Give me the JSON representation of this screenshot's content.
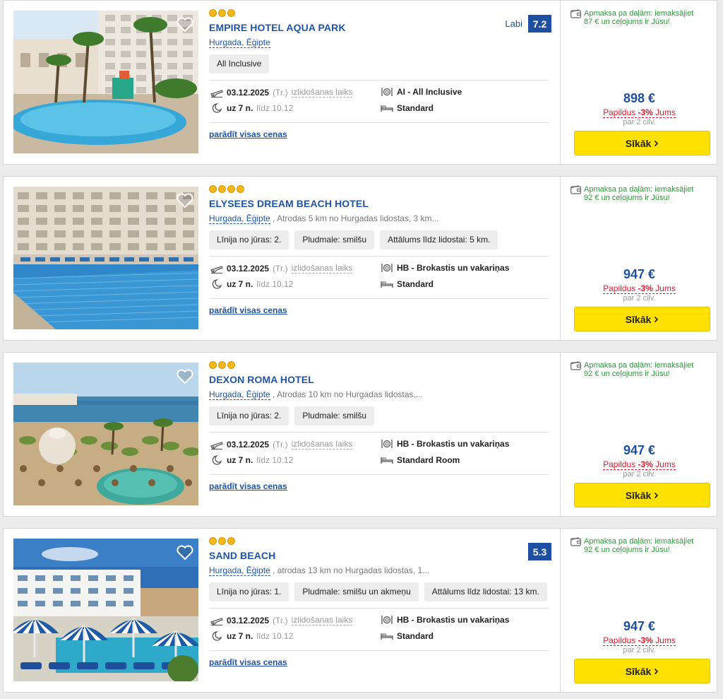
{
  "hotels": [
    {
      "name": "EMPIRE HOTEL AQUA PARK",
      "stars": 3,
      "place": "Hurgada, Ēģipte",
      "loc_extra": "",
      "tags": [
        "All Inclusive"
      ],
      "rating_word": "Labi",
      "rating_score": "7.2",
      "date": "03.12.2025",
      "weekday": "(Tr.)",
      "departure_label": "izlidošanas laiks",
      "nights": "uz 7 n.",
      "until": "līdz 10.12",
      "board": "AI - All Inclusive",
      "room": "Standard",
      "link": "parādīt visas cenas",
      "promo": "Apmaksa pa daļām: iemaksājiet 87 € un ceļojums ir Jūsu!",
      "price": "898 €",
      "discount_pre": "Papildus ",
      "discount_pct": "-3%",
      "discount_post": " Jums",
      "per": "par 2 cilv.",
      "button": "Sīkāk"
    },
    {
      "name": "ELYSEES DREAM BEACH HOTEL",
      "stars": 4,
      "place": "Hurgada, Ēģipte",
      "loc_extra": " , Atrodas 5 km no Hurgadas lidostas, 3 km...",
      "tags": [
        "Līnija no jūras: 2.",
        "Pludmale: smilšu",
        "Attālums līdz lidostai: 5 km."
      ],
      "rating_word": "",
      "rating_score": "",
      "date": "03.12.2025",
      "weekday": "(Tr.)",
      "departure_label": "izlidošanas laiks",
      "nights": "uz 7 n.",
      "until": "līdz 10.12",
      "board": "HB - Brokastis un vakariņas",
      "room": "Standard",
      "link": "parādīt visas cenas",
      "promo": "Apmaksa pa daļām: iemaksājiet 92 € un ceļojums ir Jūsu!",
      "price": "947 €",
      "discount_pre": "Papildus ",
      "discount_pct": "-3%",
      "discount_post": " Jums",
      "per": "par 2 cilv.",
      "button": "Sīkāk"
    },
    {
      "name": "DEXON ROMA HOTEL",
      "stars": 3,
      "place": "Hurgada, Ēģipte",
      "loc_extra": " , Atrodas 10 km no Hurgadas lidostas,...",
      "tags": [
        "Līnija no jūras: 2.",
        "Pludmale: smilšu"
      ],
      "rating_word": "",
      "rating_score": "",
      "date": "03.12.2025",
      "weekday": "(Tr.)",
      "departure_label": "izlidošanas laiks",
      "nights": "uz 7 n.",
      "until": "līdz 10.12",
      "board": "HB - Brokastis un vakariņas",
      "room": "Standard Room",
      "link": "parādīt visas cenas",
      "promo": "Apmaksa pa daļām: iemaksājiet 92 € un ceļojums ir Jūsu!",
      "price": "947 €",
      "discount_pre": "Papildus ",
      "discount_pct": "-3%",
      "discount_post": " Jums",
      "per": "par 2 cilv.",
      "button": "Sīkāk"
    },
    {
      "name": "SAND BEACH",
      "stars": 3,
      "place": "Hurgada, Ēģipte",
      "loc_extra": " , atrodas 13 km no Hurgadas lidostas, 1...",
      "tags": [
        "Līnija no jūras: 1.",
        "Pludmale: smilšu un akmeņu",
        "Attālums līdz lidostai: 13 km."
      ],
      "rating_word": "",
      "rating_score": "5.3",
      "date": "03.12.2025",
      "weekday": "(Tr.)",
      "departure_label": "izlidošanas laiks",
      "nights": "uz 7 n.",
      "until": "līdz 10.12",
      "board": "HB - Brokastis un vakariņas",
      "room": "Standard",
      "link": "parādīt visas cenas",
      "promo": "Apmaksa pa daļām: iemaksājiet 92 € un ceļojums ir Jūsu!",
      "price": "947 €",
      "discount_pre": "Papildus ",
      "discount_pct": "-3%",
      "discount_post": " Jums",
      "per": "par 2 cilv.",
      "button": "Sīkāk"
    }
  ],
  "colors": {
    "link_blue": "#1f55a8",
    "score_bg": "#1f4fa0",
    "button_yellow": "#ffe100",
    "promo_green": "#2f9a3a",
    "discount_red": "#e3172b",
    "star_gold": "#f2b81b"
  },
  "icons": {
    "favorite": "heart-outline-icon",
    "flight": "plane-icon",
    "nights": "moon-icon",
    "board": "cutlery-plate-icon",
    "room": "bed-icon",
    "promo": "wallet-icon",
    "button": "chevron-right-icon"
  }
}
